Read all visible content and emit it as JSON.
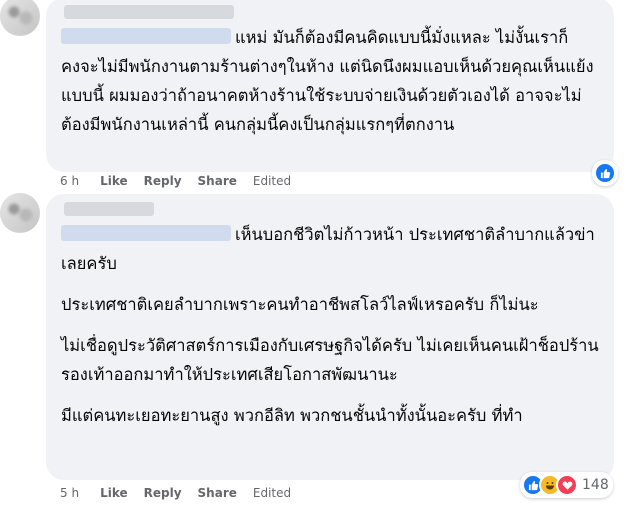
{
  "comments": [
    {
      "paragraphs": [
        "แหม่ มันก็ต้องมีคนคิดแบบนี้มั่งแหละ ไม่งั้นเราก็คงจะไม่มีพนักงานตามร้านต่างๆในห้าง แต่นิดนึงผมแอบเห็นด้วยคุณเห็นแย้งแบบนี้ ผมมองว่าถ้าอนาคตห้างร้านใช้ระบบจ่ายเงินด้วยตัวเองได้ อาจจะไม่ต้องมีพนักงานเหล่านี้ คนกลุ่มนี้คงเป็นกลุ่มแรกๆที่ตกงาน"
      ],
      "time": "6 h",
      "like_label": "Like",
      "reply_label": "Reply",
      "share_label": "Share",
      "edited_label": "Edited",
      "reactions": [
        "like-icon"
      ]
    },
    {
      "paragraphs": [
        "เห็นบอกชีวิตไม่ก้าวหน้า ประเทศชาติลำบากแล้วข่าเลยครับ",
        "ประเทศชาติเคยลำบากเพราะคนทำอาชีพสโลว์ไลฟ์เหรอครับ ก็ไม่นะ",
        "ไม่เชื่อดูประวัติศาสตร์การเมืองกับเศรษฐกิจได้ครับ ไม่เคยเห็นคนเฝ้าช็อปร้านรองเท้าออกมาทำให้ประเทศเสียโอกาสพัฒนานะ",
        "มีแต่คนทะเยอทะยานสูง พวกอีลิท พวกชนชั้นนำทั้งนั้นอะครับ ที่ทำ"
      ],
      "time": "5 h",
      "like_label": "Like",
      "reply_label": "Reply",
      "share_label": "Share",
      "edited_label": "Edited",
      "reactions": [
        "like-icon",
        "haha-icon",
        "love-icon"
      ],
      "reaction_count": "148"
    }
  ],
  "colors": {
    "bubble": "#f0f2f5",
    "meta": "#65676b",
    "like": "#1877f2"
  }
}
